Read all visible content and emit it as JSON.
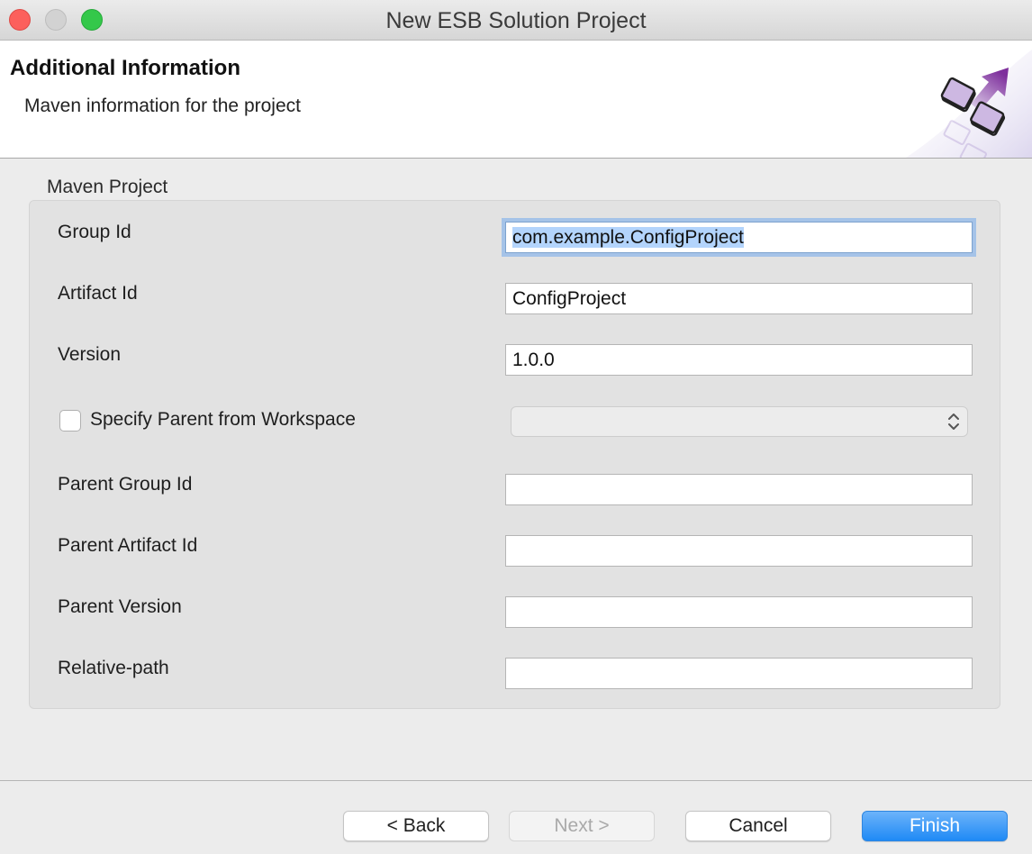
{
  "window": {
    "title": "New ESB Solution Project"
  },
  "header": {
    "title": "Additional Information",
    "description": "Maven information for the project"
  },
  "group": {
    "label": "Maven Project"
  },
  "fields": {
    "group_id": {
      "label": "Group Id",
      "value": "com.example.ConfigProject"
    },
    "artifact_id": {
      "label": "Artifact Id",
      "value": "ConfigProject"
    },
    "version": {
      "label": "Version",
      "value": "1.0.0"
    },
    "specify_parent": {
      "label": "Specify Parent from Workspace",
      "checked": false,
      "selected": ""
    },
    "parent_group_id": {
      "label": "Parent Group Id",
      "value": ""
    },
    "parent_artifact_id": {
      "label": "Parent Artifact Id",
      "value": ""
    },
    "parent_version": {
      "label": "Parent Version",
      "value": ""
    },
    "relative_path": {
      "label": "Relative-path",
      "value": ""
    }
  },
  "buttons": {
    "back": "< Back",
    "next": "Next >",
    "cancel": "Cancel",
    "finish": "Finish"
  },
  "colors": {
    "accent": "#1f8af5",
    "selection": "#b3d4fc",
    "focus_ring": "#a5c3e8",
    "banner_arrow": "#8b3fa6"
  },
  "icons": {
    "banner": "wizard-banner-icon",
    "combo": "updown-arrows-icon"
  }
}
